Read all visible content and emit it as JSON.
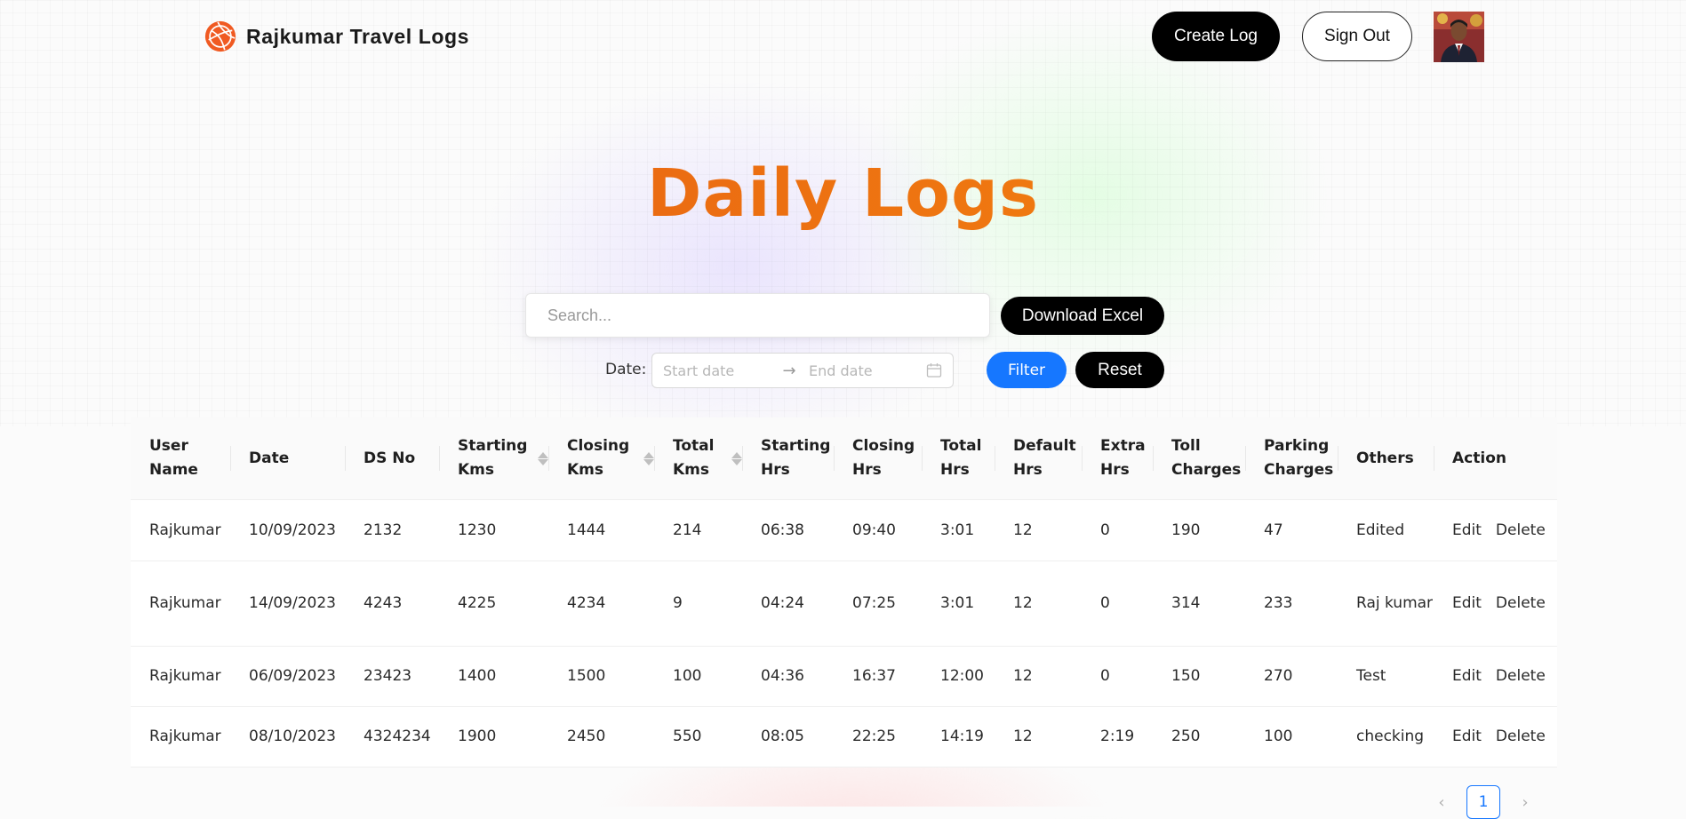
{
  "header": {
    "brand_name": "Rajkumar Travel Logs",
    "create_log_label": "Create Log",
    "sign_out_label": "Sign Out",
    "logo_icon": "globe-icon",
    "logo_color": "#f05a22"
  },
  "page": {
    "title": "Daily Logs"
  },
  "search": {
    "placeholder": "Search...",
    "download_label": "Download Excel"
  },
  "date_filter": {
    "label": "Date",
    "start_placeholder": "Start date",
    "end_placeholder": "End date",
    "filter_label": "Filter",
    "reset_label": "Reset"
  },
  "table": {
    "columns": [
      {
        "label": "User Name"
      },
      {
        "label": "Date"
      },
      {
        "label": "DS No"
      },
      {
        "label": "Starting Kms",
        "sortable": true
      },
      {
        "label": "Closing Kms",
        "sortable": true
      },
      {
        "label": "Total Kms",
        "sortable": true
      },
      {
        "label": "Starting Hrs"
      },
      {
        "label": "Closing Hrs"
      },
      {
        "label": "Total Hrs"
      },
      {
        "label": "Default Hrs"
      },
      {
        "label": "Extra Hrs"
      },
      {
        "label": "Toll Charges"
      },
      {
        "label": "Parking Charges"
      },
      {
        "label": "Others"
      },
      {
        "label": "Action"
      }
    ],
    "rows": [
      [
        "Rajkumar",
        "10/09/2023",
        "2132",
        "1230",
        "1444",
        "214",
        "06:38",
        "09:40",
        "3:01",
        "12",
        "0",
        "190",
        "47",
        "Edited"
      ],
      [
        "Rajkumar",
        "14/09/2023",
        "4243",
        "4225",
        "4234",
        "9",
        "04:24",
        "07:25",
        "3:01",
        "12",
        "0",
        "314",
        "233",
        "Raj kumar"
      ],
      [
        "Rajkumar",
        "06/09/2023",
        "23423",
        "1400",
        "1500",
        "100",
        "04:36",
        "16:37",
        "12:00",
        "12",
        "0",
        "150",
        "270",
        "Test"
      ],
      [
        "Rajkumar",
        "08/10/2023",
        "4324234",
        "1900",
        "2450",
        "550",
        "08:05",
        "22:25",
        "14:19",
        "12",
        "2:19",
        "250",
        "100",
        "checking"
      ]
    ],
    "edit_label": "Edit",
    "delete_label": "Delete"
  },
  "pagination": {
    "current_page": "1",
    "prev_icon": "chevron-left-icon",
    "next_icon": "chevron-right-icon"
  },
  "colors": {
    "primary": "#1677ff",
    "dark_button": "#000000",
    "title_gradient_start": "#f39a10",
    "title_gradient_mid": "#ea6a12",
    "title_gradient_end": "#f2b015"
  }
}
